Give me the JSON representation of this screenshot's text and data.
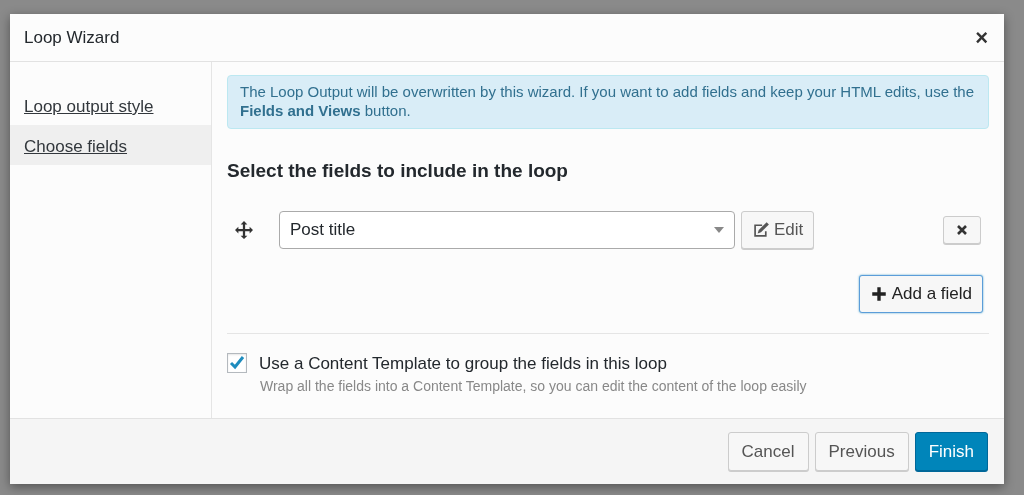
{
  "dialog": {
    "title": "Loop Wizard",
    "close": "×"
  },
  "steps": [
    {
      "label": "Loop output style",
      "selected": false
    },
    {
      "label": "Choose fields",
      "selected": true
    }
  ],
  "notice": "The Loop Output will be overwritten by this wizard. If you want to add fields and keep your HTML edits, use the **Fields and Views** button.",
  "heading": "Select the fields to include in the loop",
  "fields": [
    {
      "value": "Post title",
      "edit_label": "Edit"
    }
  ],
  "add_field_label": "Add a field",
  "template_option": {
    "label": "Use a Content Template to group the fields in this loop",
    "checked": true,
    "help": "Wrap all the fields into a Content Template, so you can edit the content of the loop easily"
  },
  "buttons": [
    {
      "label": "Cancel",
      "kind": "default"
    },
    {
      "label": "Previous",
      "kind": "default"
    },
    {
      "label": "Finish",
      "kind": "primary"
    }
  ]
}
